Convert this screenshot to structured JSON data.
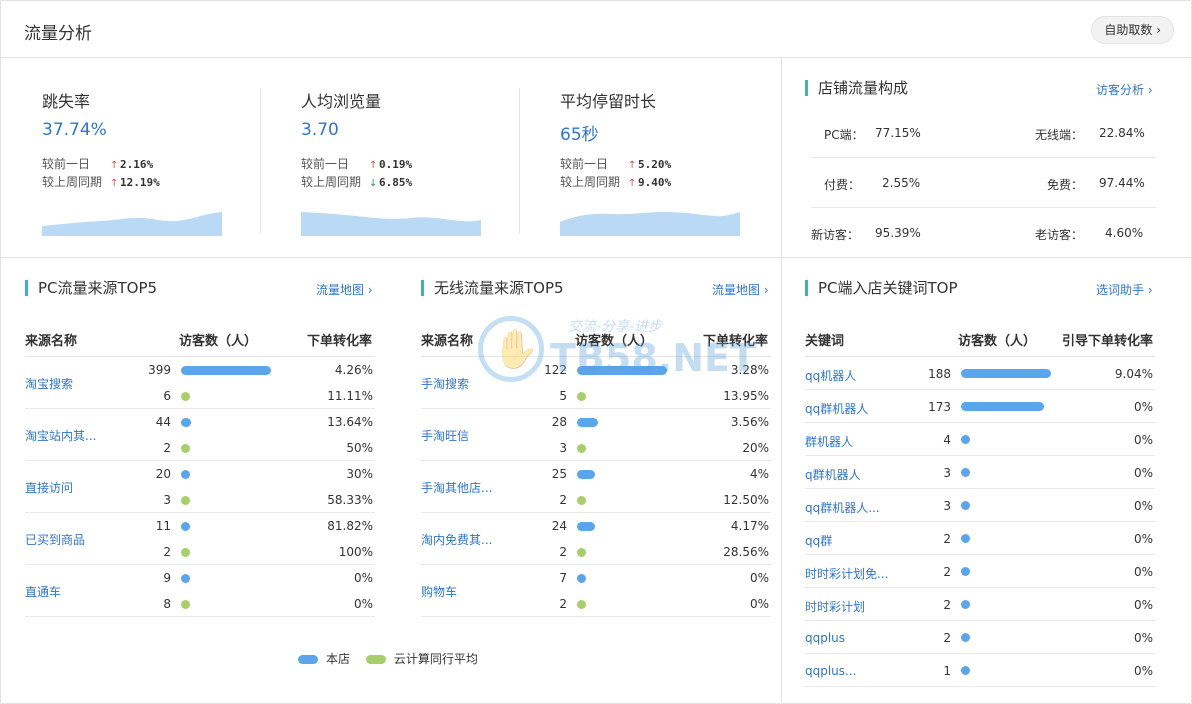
{
  "header": {
    "title": "流量分析",
    "self_service_label": "自助取数 ›"
  },
  "metrics": [
    {
      "title": "跳失率",
      "value": "37.74%",
      "rows": [
        {
          "label": "较前一日",
          "dir": "up",
          "pct": "2.16%"
        },
        {
          "label": "较上周同期",
          "dir": "up",
          "pct": "12.19%"
        }
      ]
    },
    {
      "title": "人均浏览量",
      "value": "3.70",
      "rows": [
        {
          "label": "较前一日",
          "dir": "up",
          "pct": "0.19%"
        },
        {
          "label": "较上周同期",
          "dir": "down",
          "pct": "6.85%"
        }
      ]
    },
    {
      "title": "平均停留时长",
      "value": "65秒",
      "rows": [
        {
          "label": "较前一日",
          "dir": "up",
          "pct": "5.20%"
        },
        {
          "label": "较上周同期",
          "dir": "up",
          "pct": "9.40%"
        }
      ]
    }
  ],
  "composition": {
    "title": "店铺流量构成",
    "link": "访客分析 ›",
    "rows": [
      {
        "k1": "PC端：",
        "v1": "77.15%",
        "k2": "无线端：",
        "v2": "22.84%"
      },
      {
        "k1": "付费：",
        "v1": "2.55%",
        "k2": "免费：",
        "v2": "97.44%"
      },
      {
        "k1": "新访客：",
        "v1": "95.39%",
        "k2": "老访客：",
        "v2": "4.60%"
      }
    ]
  },
  "pc_sources": {
    "title": "PC流量来源TOP5",
    "link": "流量地图 ›",
    "headers": [
      "来源名称",
      "访客数（人）",
      "下单转化率"
    ],
    "rows": [
      {
        "name": "淘宝搜索",
        "store": 399,
        "store_rate": "4.26%",
        "avg": 6,
        "avg_rate": "11.11%"
      },
      {
        "name": "淘宝站内其...",
        "store": 44,
        "store_rate": "13.64%",
        "avg": 2,
        "avg_rate": "50%"
      },
      {
        "name": "直接访问",
        "store": 20,
        "store_rate": "30%",
        "avg": 3,
        "avg_rate": "58.33%"
      },
      {
        "name": "已买到商品",
        "store": 11,
        "store_rate": "81.82%",
        "avg": 2,
        "avg_rate": "100%"
      },
      {
        "name": "直通车",
        "store": 9,
        "store_rate": "0%",
        "avg": 8,
        "avg_rate": "0%"
      }
    ]
  },
  "mobile_sources": {
    "title": "无线流量来源TOP5",
    "link": "流量地图 ›",
    "headers": [
      "来源名称",
      "访客数（人）",
      "下单转化率"
    ],
    "rows": [
      {
        "name": "手淘搜索",
        "store": 122,
        "store_rate": "3.28%",
        "avg": 5,
        "avg_rate": "13.95%"
      },
      {
        "name": "手淘旺信",
        "store": 28,
        "store_rate": "3.56%",
        "avg": 3,
        "avg_rate": "20%"
      },
      {
        "name": "手淘其他店...",
        "store": 25,
        "store_rate": "4%",
        "avg": 2,
        "avg_rate": "12.50%"
      },
      {
        "name": "淘内免费其...",
        "store": 24,
        "store_rate": "4.17%",
        "avg": 2,
        "avg_rate": "28.56%"
      },
      {
        "name": "购物车",
        "store": 7,
        "store_rate": "0%",
        "avg": 2,
        "avg_rate": "0%"
      }
    ]
  },
  "keywords": {
    "title": "PC端入店关键词TOP",
    "link": "选词助手 ›",
    "headers": [
      "关键词",
      "访客数（人）",
      "引导下单转化率"
    ],
    "rows": [
      {
        "name": "qq机器人",
        "count": 188,
        "rate": "9.04%"
      },
      {
        "name": "qq群机器人",
        "count": 173,
        "rate": "0%"
      },
      {
        "name": "群机器人",
        "count": 4,
        "rate": "0%"
      },
      {
        "name": "q群机器人",
        "count": 3,
        "rate": "0%"
      },
      {
        "name": "qq群机器人...",
        "count": 3,
        "rate": "0%"
      },
      {
        "name": "qq群",
        "count": 2,
        "rate": "0%"
      },
      {
        "name": "时时彩计划免...",
        "count": 2,
        "rate": "0%"
      },
      {
        "name": "时时彩计划",
        "count": 2,
        "rate": "0%"
      },
      {
        "name": "qqplus",
        "count": 2,
        "rate": "0%"
      },
      {
        "name": "qqplus...",
        "count": 1,
        "rate": "0%"
      }
    ]
  },
  "legend": {
    "store": "本店",
    "avg": "云计算同行平均"
  },
  "watermark": {
    "text": "TB58.NET",
    "slogan": "交流-分享-进步"
  },
  "colors": {
    "accent": "#2f75c8",
    "bar_store": "#5aa5eb",
    "bar_avg": "#a6cf6a",
    "section_marker": "#3fb4b3",
    "spark_fill": "#b9d9f5"
  }
}
